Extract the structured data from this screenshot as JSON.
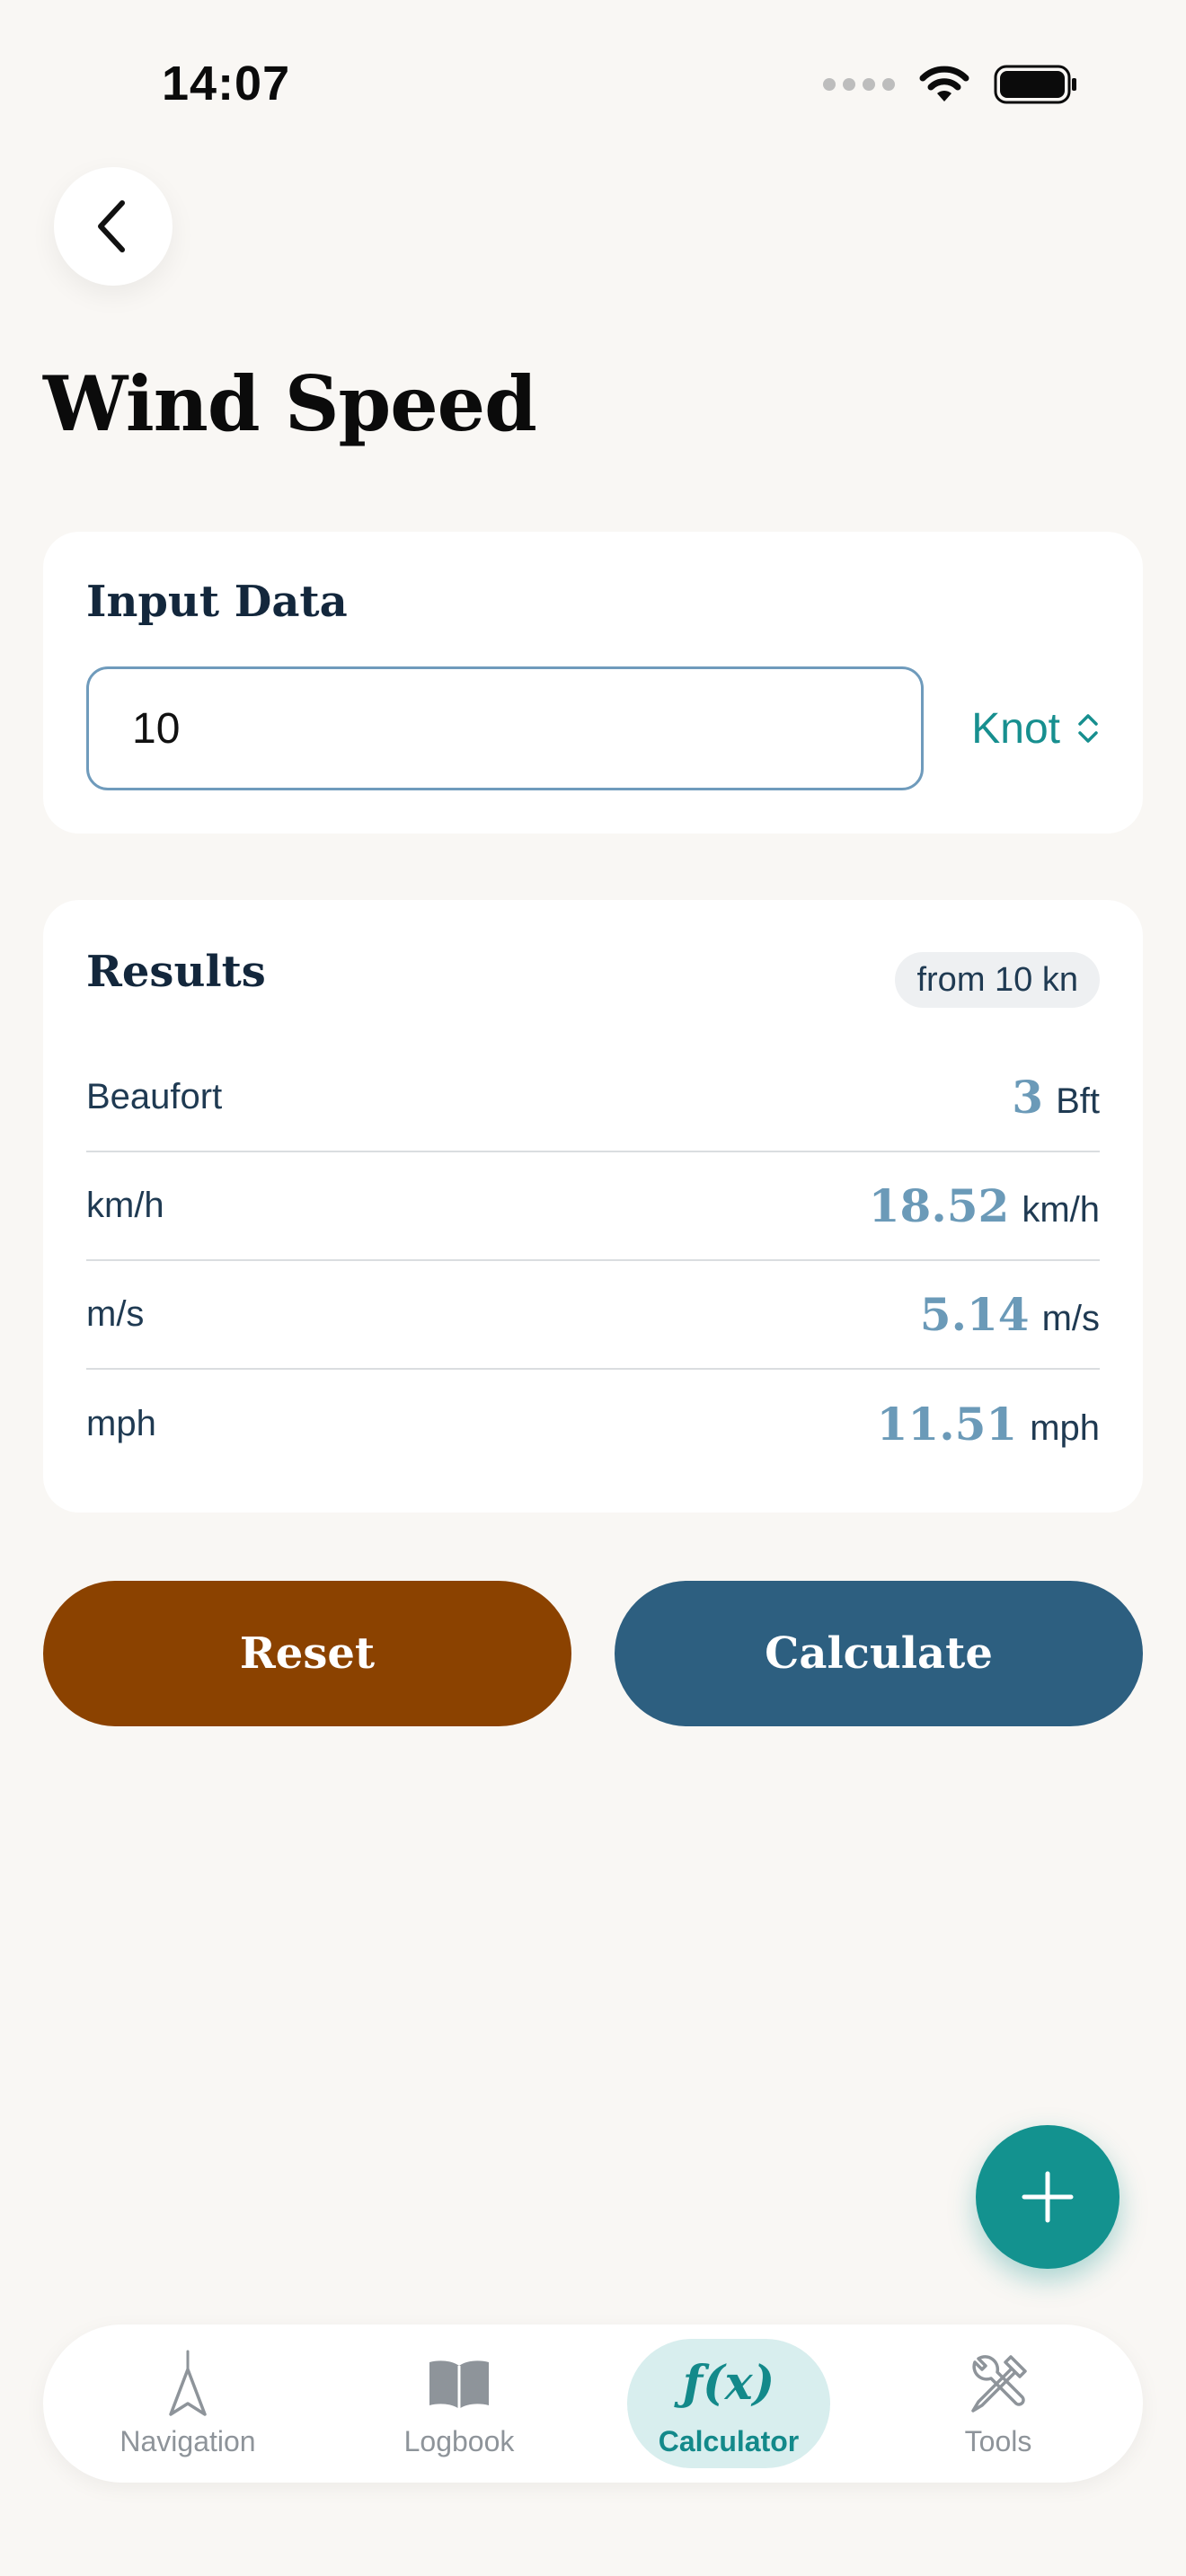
{
  "status_bar": {
    "time": "14:07"
  },
  "header": {
    "title": "Wind Speed",
    "back_icon": "chevron-left-icon"
  },
  "input_card": {
    "heading": "Input Data",
    "value": "10",
    "unit": "Knot",
    "unit_icon": "chevron-up-down-icon"
  },
  "results_card": {
    "heading": "Results",
    "source_chip": "from 10 kn",
    "rows": [
      {
        "label": "Beaufort",
        "value": "3",
        "unit": "Bft"
      },
      {
        "label": "km/h",
        "value": "18.52",
        "unit": "km/h"
      },
      {
        "label": "m/s",
        "value": "5.14",
        "unit": "m/s"
      },
      {
        "label": "mph",
        "value": "11.51",
        "unit": "mph"
      }
    ]
  },
  "actions": {
    "reset_label": "Reset",
    "calculate_label": "Calculate"
  },
  "fab": {
    "icon": "plus-icon"
  },
  "tabbar": {
    "items": [
      {
        "label": "Navigation",
        "icon": "compass-arrow-icon"
      },
      {
        "label": "Logbook",
        "icon": "book-icon"
      },
      {
        "label": "Calculator",
        "icon": "function-icon",
        "glyph": "ƒ(x)",
        "active": true
      },
      {
        "label": "Tools",
        "icon": "tools-icon"
      }
    ]
  },
  "colors": {
    "background": "#f9f7f4",
    "reset": "#8b4200",
    "calculate": "#2d5f80",
    "accent": "#13928f",
    "result_value": "#6b9ab8"
  }
}
